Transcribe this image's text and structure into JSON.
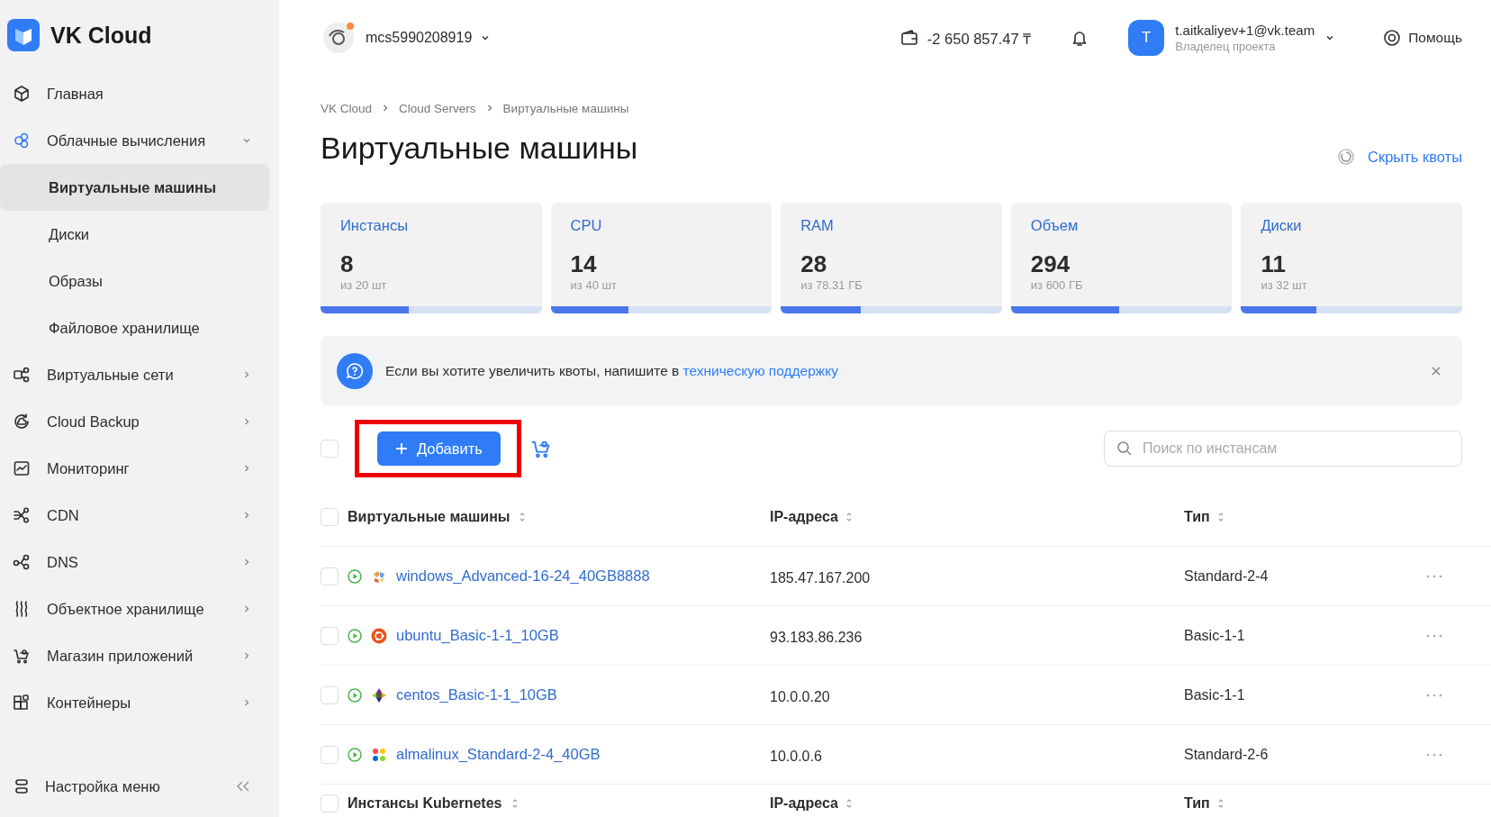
{
  "sidebar": {
    "logo": "VK Cloud",
    "items": [
      {
        "kind": "cube",
        "label": "Главная",
        "selected": false
      },
      {
        "kind": "cloud",
        "label": "Облачные вычисления",
        "selected": false,
        "expanded": true,
        "children": [
          {
            "label": "Виртуальные машины",
            "selected": true
          },
          {
            "label": "Диски",
            "selected": false
          },
          {
            "label": "Образы",
            "selected": false
          },
          {
            "label": "Файловое хранилище",
            "selected": false
          }
        ]
      },
      {
        "kind": "network",
        "label": "Виртуальные сети",
        "selected": false,
        "expanded": false
      },
      {
        "kind": "backup",
        "label": "Cloud Backup",
        "selected": false,
        "expanded": false
      },
      {
        "kind": "monitor",
        "label": "Мониторинг",
        "selected": false,
        "expanded": false
      },
      {
        "kind": "cdn",
        "label": "CDN",
        "selected": false,
        "expanded": false
      },
      {
        "kind": "dns",
        "label": "DNS",
        "selected": false,
        "expanded": false
      },
      {
        "kind": "storage",
        "label": "Объектное хранилище",
        "selected": false,
        "expanded": false
      },
      {
        "kind": "cart",
        "label": "Магазин приложений",
        "selected": false,
        "expanded": false
      },
      {
        "kind": "containers",
        "label": "Контейнеры",
        "selected": false,
        "expanded": false
      }
    ],
    "footer": {
      "label": "Настройка меню"
    }
  },
  "header": {
    "project": "mcs5990208919",
    "balance": "-2 650 857.47 ₸",
    "user": {
      "avatar": "T",
      "email": "t.aitkaliyev+1@vk.team",
      "role": "Владелец проекта"
    },
    "help": "Помощь"
  },
  "breadcrumbs": [
    "VK Cloud",
    "Cloud Servers",
    "Виртуальные машины"
  ],
  "title": "Виртуальные машины",
  "hide_quotas": "Скрыть квоты",
  "quotas": [
    {
      "label": "Инстансы",
      "value": "8",
      "limit": "из 20 шт",
      "level": 0.4
    },
    {
      "label": "CPU",
      "value": "14",
      "limit": "из 40 шт",
      "level": 0.35
    },
    {
      "label": "RAM",
      "value": "28",
      "limit": "из 78.31 ГБ",
      "level": 0.36
    },
    {
      "label": "Объем",
      "value": "294",
      "limit": "из 600 ГБ",
      "level": 0.49
    },
    {
      "label": "Диски",
      "value": "11",
      "limit": "из 32 шт",
      "level": 0.34
    }
  ],
  "banner": {
    "text": "Если вы хотите увеличить квоты, напишите в ",
    "link": "техническую поддержку"
  },
  "toolbar": {
    "select_all_checked": false,
    "add_button": {
      "label": "Добавить",
      "highlighted": true
    },
    "search": {
      "placeholder": "Поиск по инстансам"
    }
  },
  "sections": [
    {
      "checked": false,
      "columns": [
        "Виртуальные машины",
        "IP-адреса",
        "Тип"
      ],
      "rows": [
        {
          "checked": false,
          "running": true,
          "kind": "windows",
          "name": "windows_Advanced-16-24_40GB8888",
          "ip": "185.47.167.200",
          "type": "Standard-2-4"
        },
        {
          "checked": false,
          "running": true,
          "kind": "ubuntu",
          "name": "ubuntu_Basic-1-1_10GB",
          "ip": "93.183.86.236",
          "type": "Basic-1-1"
        },
        {
          "checked": false,
          "running": true,
          "kind": "centos",
          "name": "centos_Basic-1-1_10GB",
          "ip": "10.0.0.20",
          "type": "Basic-1-1"
        },
        {
          "checked": false,
          "running": true,
          "kind": "alma",
          "name": "almalinux_Standard-2-4_40GB",
          "ip": "10.0.0.6",
          "type": "Standard-2-6"
        }
      ]
    },
    {
      "checked": false,
      "columns": [
        "Инстансы Kubernetes",
        "IP-адреса",
        "Тип"
      ]
    }
  ]
}
